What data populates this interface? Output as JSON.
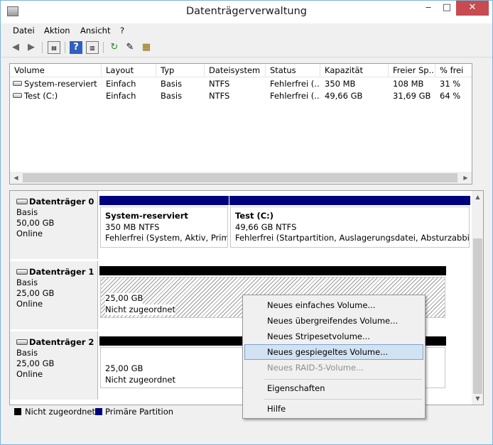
{
  "window": {
    "title": "Datenträgerverwaltung",
    "minimize": "‒",
    "maximize": "□",
    "close": "✕"
  },
  "menu": [
    "Datei",
    "Aktion",
    "Ansicht",
    "?"
  ],
  "volume_list": {
    "columns": [
      "Volume",
      "Layout",
      "Typ",
      "Dateisystem",
      "Status",
      "Kapazität",
      "Freier Sp...",
      "% frei"
    ],
    "rows": [
      [
        "System-reserviert",
        "Einfach",
        "Basis",
        "NTFS",
        "Fehlerfrei (...",
        "350 MB",
        "108 MB",
        "31 %"
      ],
      [
        "Test (C:)",
        "Einfach",
        "Basis",
        "NTFS",
        "Fehlerfrei (...",
        "49,66 GB",
        "31,69 GB",
        "64 %"
      ]
    ]
  },
  "disks": [
    {
      "name": "Datenträger 0",
      "type": "Basis",
      "size": "50,00 GB",
      "status": "Online",
      "partitions": [
        {
          "title": "System-reserviert",
          "line2": "350 MB NTFS",
          "line3": "Fehlerfrei (System, Aktiv, Primäre Partition)"
        },
        {
          "title": "Test  (C:)",
          "line2": "49,66 GB NTFS",
          "line3": "Fehlerfrei (Startpartition, Auslagerungsdatei, Absturzabbild, Primäre Partition)"
        }
      ]
    },
    {
      "name": "Datenträger 1",
      "type": "Basis",
      "size": "25,00 GB",
      "status": "Online",
      "partitions": [
        {
          "line2": "25,00 GB",
          "line3": "Nicht zugeordnet"
        }
      ]
    },
    {
      "name": "Datenträger 2",
      "type": "Basis",
      "size": "25,00 GB",
      "status": "Online",
      "partitions": [
        {
          "line2": "25,00 GB",
          "line3": "Nicht zugeordnet"
        }
      ]
    }
  ],
  "legend": [
    {
      "label": "Nicht zugeordnet",
      "color": "#000000"
    },
    {
      "label": "Primäre Partition",
      "color": "#00007f"
    }
  ],
  "context_menu": {
    "items": [
      {
        "label": "Neues einfaches Volume...",
        "state": "normal"
      },
      {
        "label": "Neues übergreifendes Volume...",
        "state": "normal"
      },
      {
        "label": "Neues Stripesetvolume...",
        "state": "normal"
      },
      {
        "label": "Neues gespiegeltes Volume...",
        "state": "highlighted"
      },
      {
        "label": "Neues RAID-5-Volume...",
        "state": "disabled"
      },
      {
        "label": "Eigenschaften",
        "state": "normal"
      },
      {
        "label": "Hilfe",
        "state": "normal"
      }
    ]
  },
  "colors": {
    "primary_partition": "#00007f",
    "unallocated": "#000000",
    "close_button": "#c74b50",
    "menu_highlight": "#d1e2f2"
  }
}
